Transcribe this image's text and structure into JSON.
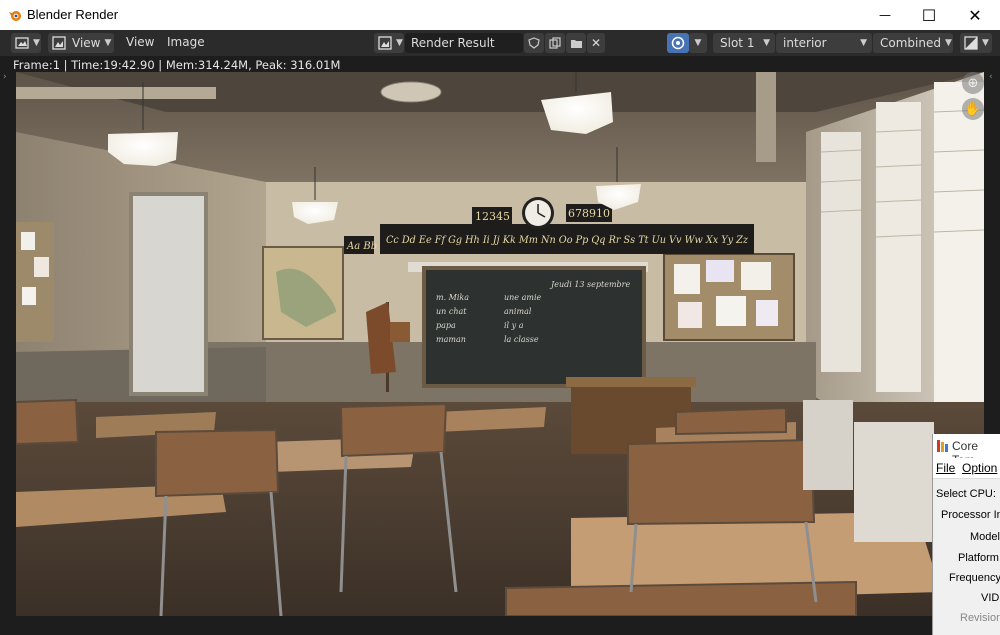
{
  "window": {
    "title": "Blender Render",
    "minimize_glyph": "—",
    "maximize_glyph": "☐",
    "close_glyph": "✕"
  },
  "header": {
    "view_menu": "View",
    "view_item": "View",
    "image_item": "Image",
    "image_name": "Render Result",
    "slot": "Slot 1",
    "layer": "interior",
    "pass": "Combined"
  },
  "status": "Frame:1 | Time:19:42.90 | Mem:314.24M, Peak: 316.01M",
  "scene": {
    "clock_left": "12345",
    "clock_right": "678910",
    "alphabet_1": "Aa Bb",
    "alphabet_2": "Cc Dd Ee Ff Gg Hh Ii Jj Kk Mm Nn Oo Pp Qq Rr Ss Tt Uu Vv Ww Xx Yy Zz",
    "board_date": "Jeudi 13 septembre",
    "board_left_1": "m. Mika",
    "board_left_2": "un chat",
    "board_left_3": "papa",
    "board_left_4": "maman",
    "board_mid_1": "une amie",
    "board_mid_2": "animal",
    "board_mid_3": "il y a",
    "board_mid_4": "la classe"
  },
  "coretemp": {
    "title": "Core Tem",
    "menu_file": "File",
    "menu_options": "Option",
    "select_cpu": "Select CPU:",
    "processor": "Processor Inf",
    "model": "Model:",
    "platform": "Platform:",
    "frequency": "Frequency:",
    "vid": "VID:",
    "revision": "Revision:"
  },
  "colors": {
    "accent": "#4772b3",
    "panel": "#2b2b2b",
    "button": "#3d3d3d"
  }
}
